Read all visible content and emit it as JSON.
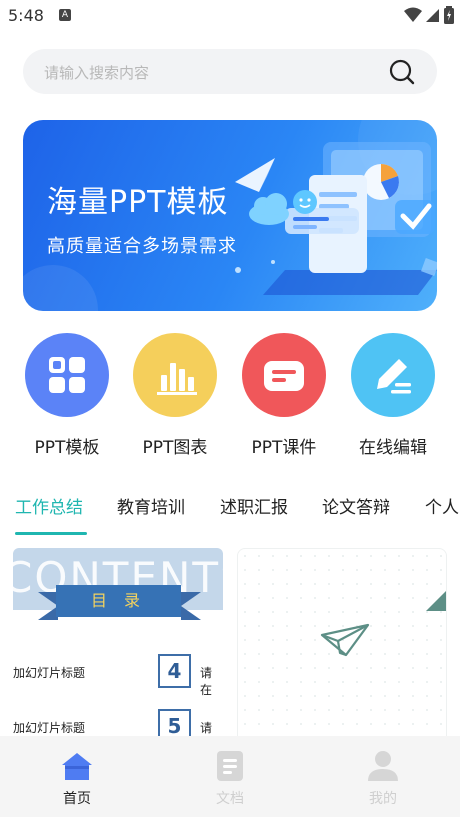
{
  "status_bar": {
    "time": "5:48",
    "notification_letter": "A"
  },
  "search": {
    "placeholder": "请输入搜索内容"
  },
  "banner": {
    "title": "海量PPT模板",
    "subtitle": "高质量适合多场景需求"
  },
  "categories": [
    {
      "label": "PPT模板",
      "color": "#5b83f7",
      "icon": "grid-icon"
    },
    {
      "label": "PPT图表",
      "color": "#f5cf5b",
      "icon": "bar-chart-icon"
    },
    {
      "label": "PPT课件",
      "color": "#f0575a",
      "icon": "courseware-icon"
    },
    {
      "label": "在线编辑",
      "color": "#4fc3f4",
      "icon": "edit-icon"
    }
  ],
  "tabs": [
    "工作总结",
    "教育培训",
    "述职汇报",
    "论文答辩",
    "个人"
  ],
  "active_tab": "工作总结",
  "accent_color": "#1fb6b0",
  "card1": {
    "header_text": "CONTENTS",
    "ribbon_text": "目 录",
    "rows": [
      {
        "title": "加幻灯片标题",
        "number": "4",
        "extra": "请在"
      },
      {
        "title": "加幻灯片标题",
        "number": "5",
        "extra": "请在"
      }
    ]
  },
  "bottom_nav": [
    {
      "label": "首页",
      "icon": "home-icon",
      "active": true
    },
    {
      "label": "文档",
      "icon": "document-icon",
      "active": false
    },
    {
      "label": "我的",
      "icon": "profile-icon",
      "active": false
    }
  ]
}
